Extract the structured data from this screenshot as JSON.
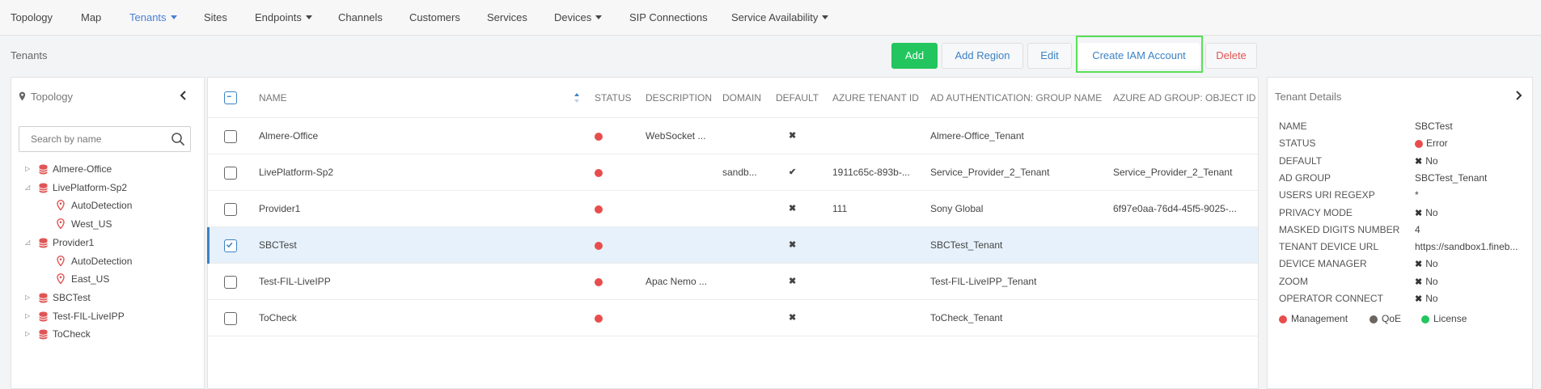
{
  "nav": {
    "items": [
      {
        "label": "Topology",
        "dropdown": false,
        "active": false
      },
      {
        "label": "Map",
        "dropdown": false,
        "active": false
      },
      {
        "label": "Tenants",
        "dropdown": true,
        "active": true
      },
      {
        "label": "Sites",
        "dropdown": false,
        "active": false
      },
      {
        "label": "Endpoints",
        "dropdown": true,
        "active": false
      },
      {
        "label": "Channels",
        "dropdown": false,
        "active": false
      },
      {
        "label": "Customers",
        "dropdown": false,
        "active": false
      },
      {
        "label": "Services",
        "dropdown": false,
        "active": false
      },
      {
        "label": "Devices",
        "dropdown": true,
        "active": false
      },
      {
        "label": "SIP Connections",
        "dropdown": false,
        "active": false
      },
      {
        "label": "Service Availability",
        "dropdown": true,
        "active": false
      }
    ]
  },
  "page": {
    "title": "Tenants"
  },
  "toolbar": {
    "add": "Add",
    "add_region": "Add Region",
    "edit": "Edit",
    "create_iam": "Create IAM Account",
    "delete": "Delete"
  },
  "tree": {
    "title": "Topology",
    "search_placeholder": "Search by name",
    "nodes": [
      {
        "label": "Almere-Office",
        "level": 0,
        "type": "tenant",
        "toggle": "▷"
      },
      {
        "label": "LivePlatform-Sp2",
        "level": 0,
        "type": "tenant",
        "toggle": "◿"
      },
      {
        "label": "AutoDetection",
        "level": 1,
        "type": "site",
        "toggle": ""
      },
      {
        "label": "West_US",
        "level": 1,
        "type": "site",
        "toggle": ""
      },
      {
        "label": "Provider1",
        "level": 0,
        "type": "tenant",
        "toggle": "◿"
      },
      {
        "label": "AutoDetection",
        "level": 1,
        "type": "site",
        "toggle": ""
      },
      {
        "label": "East_US",
        "level": 1,
        "type": "site",
        "toggle": ""
      },
      {
        "label": "SBCTest",
        "level": 0,
        "type": "tenant",
        "toggle": "▷"
      },
      {
        "label": "Test-FIL-LiveIPP",
        "level": 0,
        "type": "tenant",
        "toggle": "▷"
      },
      {
        "label": "ToCheck",
        "level": 0,
        "type": "tenant",
        "toggle": "▷"
      }
    ]
  },
  "grid": {
    "columns": [
      "NAME",
      "STATUS",
      "DESCRIPTION",
      "DOMAIN",
      "DEFAULT",
      "AZURE TENANT ID",
      "AD AUTHENTICATION: GROUP NAME",
      "AZURE AD GROUP: OBJECT ID"
    ],
    "rows": [
      {
        "name": "Almere-Office",
        "status": "error",
        "description": "WebSocket ...",
        "domain": "",
        "default": "✖",
        "azure_tenant_id": "",
        "ad_group": "Almere-Office_Tenant",
        "ad_object_id": "",
        "checked": false,
        "selected": false
      },
      {
        "name": "LivePlatform-Sp2",
        "status": "error",
        "description": "",
        "domain": "sandb...",
        "default": "✔",
        "azure_tenant_id": "1911c65c-893b-...",
        "ad_group": "Service_Provider_2_Tenant",
        "ad_object_id": "Service_Provider_2_Tenant",
        "checked": false,
        "selected": false
      },
      {
        "name": "Provider1",
        "status": "error",
        "description": "",
        "domain": "",
        "default": "✖",
        "azure_tenant_id": "111",
        "ad_group": "Sony Global",
        "ad_object_id": "6f97e0aa-76d4-45f5-9025-...",
        "checked": false,
        "selected": false
      },
      {
        "name": "SBCTest",
        "status": "error",
        "description": "",
        "domain": "",
        "default": "✖",
        "azure_tenant_id": "",
        "ad_group": "SBCTest_Tenant",
        "ad_object_id": "",
        "checked": true,
        "selected": true
      },
      {
        "name": "Test-FIL-LiveIPP",
        "status": "error",
        "description": "Apac Nemo ...",
        "domain": "",
        "default": "✖",
        "azure_tenant_id": "",
        "ad_group": "Test-FIL-LiveIPP_Tenant",
        "ad_object_id": "",
        "checked": false,
        "selected": false
      },
      {
        "name": "ToCheck",
        "status": "error",
        "description": "",
        "domain": "",
        "default": "✖",
        "azure_tenant_id": "",
        "ad_group": "ToCheck_Tenant",
        "ad_object_id": "",
        "checked": false,
        "selected": false
      }
    ]
  },
  "details": {
    "title": "Tenant Details",
    "fields": [
      {
        "key": "NAME",
        "value": "SBCTest",
        "mark": ""
      },
      {
        "key": "STATUS",
        "value": "Error",
        "mark": "dot"
      },
      {
        "key": "DEFAULT",
        "value": "No",
        "mark": "x"
      },
      {
        "key": "AD GROUP",
        "value": "SBCTest_Tenant",
        "mark": ""
      },
      {
        "key": "USERS URI REGEXP",
        "value": "*",
        "mark": ""
      },
      {
        "key": "PRIVACY MODE",
        "value": "No",
        "mark": "x"
      },
      {
        "key": "MASKED DIGITS NUMBER",
        "value": "4",
        "mark": ""
      },
      {
        "key": "TENANT DEVICE URL",
        "value": "https://sandbox1.fineb...",
        "mark": ""
      },
      {
        "key": "DEVICE MANAGER",
        "value": "No",
        "mark": "x"
      },
      {
        "key": "ZOOM",
        "value": "No",
        "mark": "x"
      },
      {
        "key": "OPERATOR CONNECT",
        "value": "No",
        "mark": "x"
      }
    ],
    "legend": [
      {
        "label": "Management",
        "color": "#e84d4d"
      },
      {
        "label": "QoE",
        "color": "#6b6460"
      },
      {
        "label": "License",
        "color": "#22c55e"
      }
    ]
  },
  "colors": {
    "accent": "#4a7fd6",
    "add_button": "#22c55e",
    "error": "#e84d4d",
    "highlight": "#58e058"
  }
}
